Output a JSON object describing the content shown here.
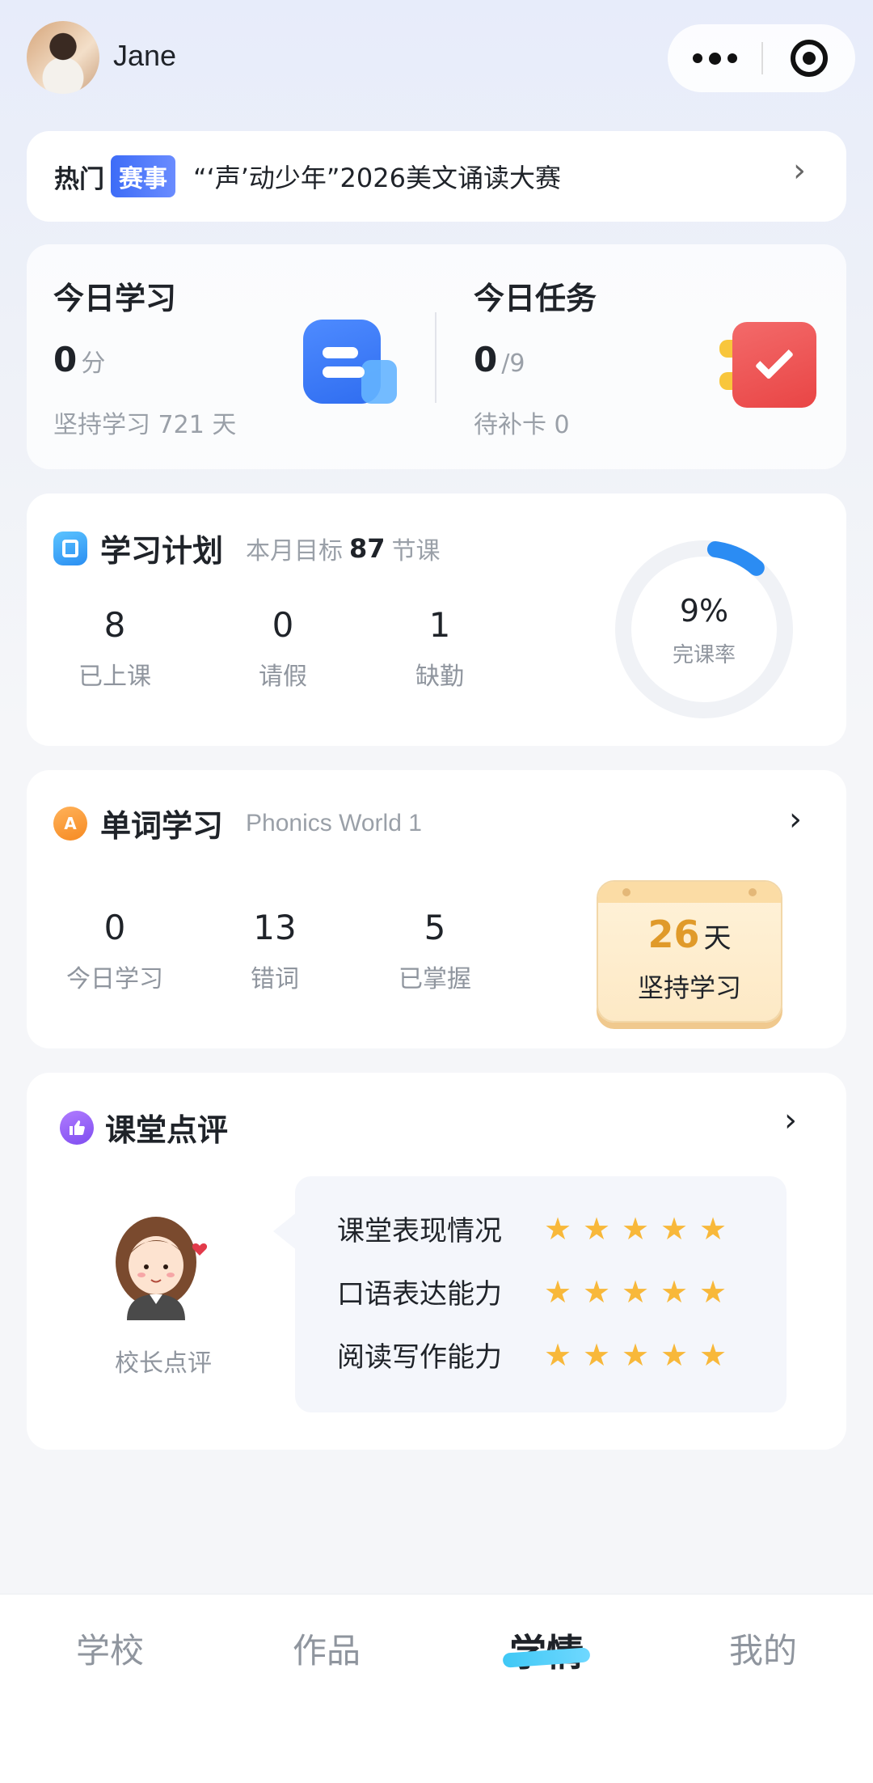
{
  "user": {
    "name": "Jane"
  },
  "banner": {
    "hot_label": "热门",
    "badge": "赛事",
    "text": "“‘声’动少年”2026美文诵读大赛"
  },
  "today_study": {
    "title": "今日学习",
    "value": "0",
    "unit": "分",
    "streak_text": "坚持学习 721 天"
  },
  "today_task": {
    "title": "今日任务",
    "value": "0",
    "total": "/9",
    "pending_text": "待补卡 0"
  },
  "study_plan": {
    "title": "学习计划",
    "goal_prefix": "本月目标",
    "goal_value": "87",
    "goal_suffix": "节课",
    "stats": [
      {
        "value": "8",
        "label": "已上课"
      },
      {
        "value": "0",
        "label": "请假"
      },
      {
        "value": "1",
        "label": "缺勤"
      }
    ],
    "completion_percent": "9%",
    "completion_label": "完课率",
    "completion_fraction": 0.09,
    "ring_color": "#2b8cf3",
    "ring_track_color": "#f0f2f6"
  },
  "word_study": {
    "title": "单词学习",
    "course": "Phonics World 1",
    "stats": [
      {
        "value": "0",
        "label": "今日学习"
      },
      {
        "value": "13",
        "label": "错词"
      },
      {
        "value": "5",
        "label": "已掌握"
      }
    ],
    "streak_days": "26",
    "streak_unit": "天",
    "streak_label": "坚持学习"
  },
  "class_review": {
    "title": "课堂点评",
    "reviewer": "校长点评",
    "items": [
      {
        "label": "课堂表现情况",
        "stars": 5
      },
      {
        "label": "口语表达能力",
        "stars": 5
      },
      {
        "label": "阅读写作能力",
        "stars": 5
      }
    ]
  },
  "tabs": [
    {
      "label": "学校"
    },
    {
      "label": "作品"
    },
    {
      "label": "学情"
    },
    {
      "label": "我的"
    }
  ],
  "active_tab": "学情",
  "colors": {
    "accent": "#2b8cf3",
    "star": "#f8b83a",
    "streak": "#e09a2a"
  },
  "icons": {
    "more": "more-dots-icon",
    "target": "target-icon",
    "chevron": "chevron-right-icon",
    "star": "star-icon"
  }
}
